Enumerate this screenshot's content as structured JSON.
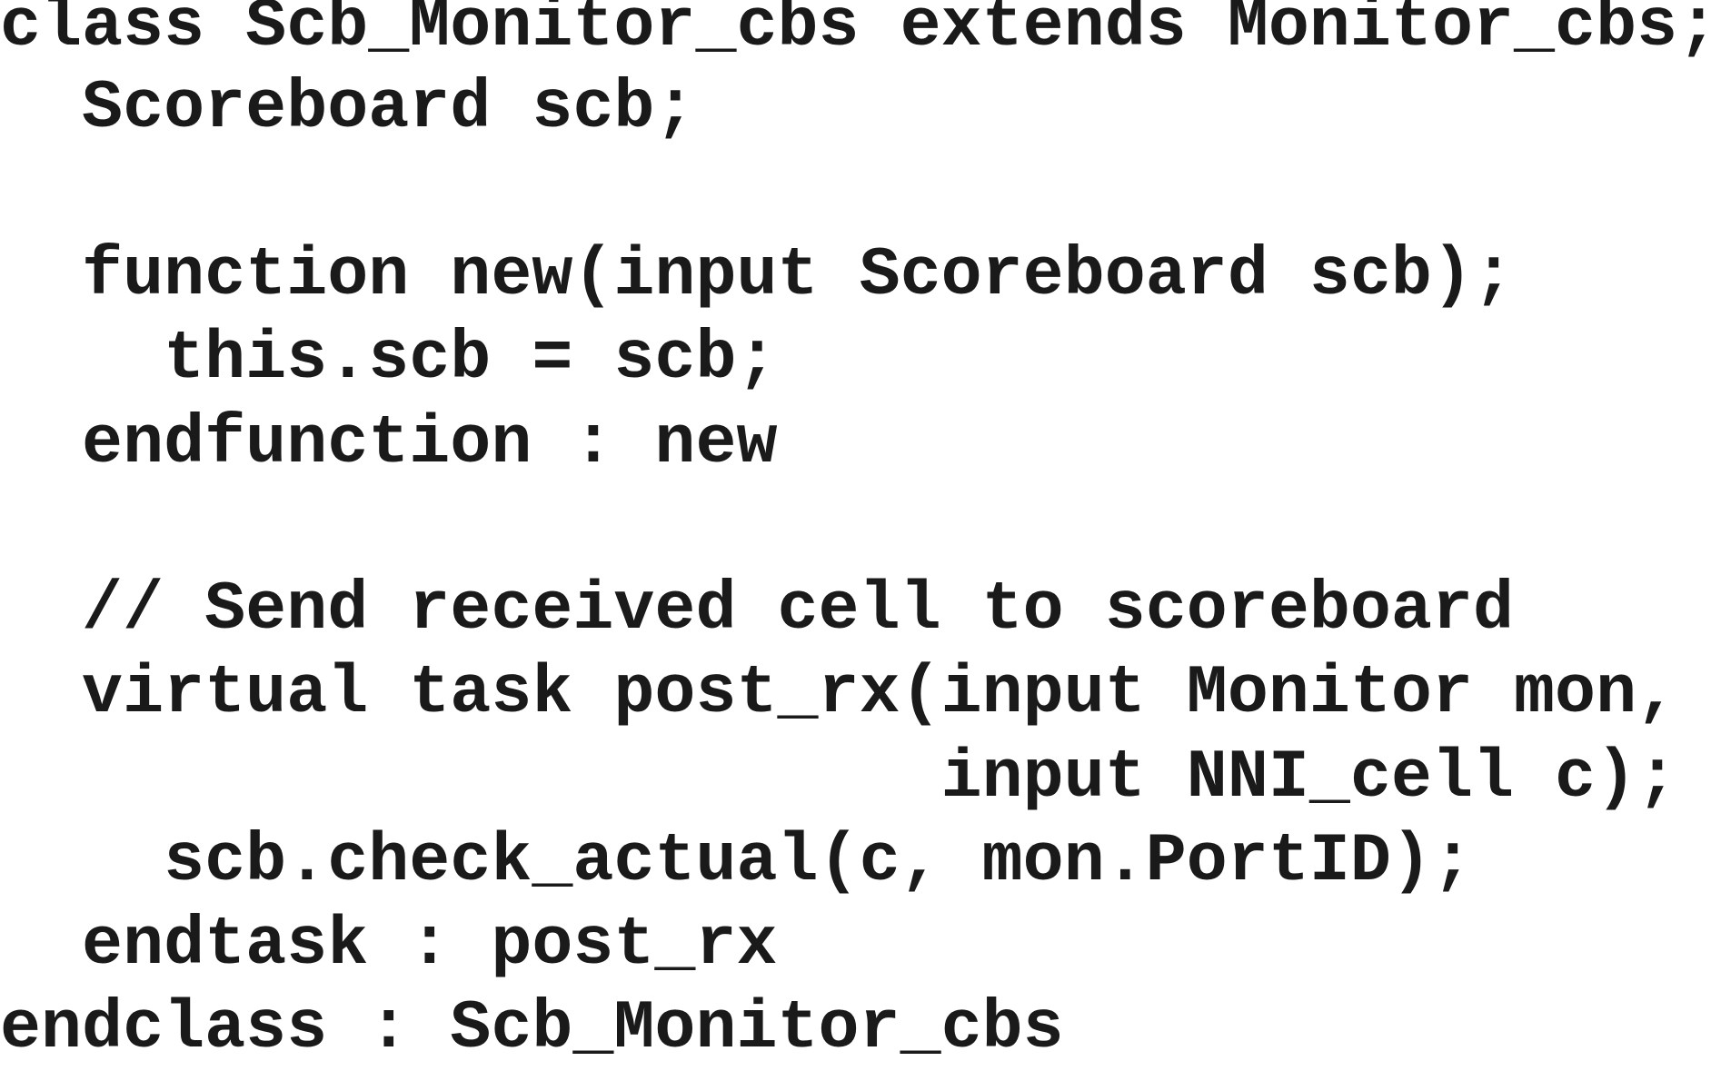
{
  "code": {
    "lines": [
      "class Scb_Monitor_cbs extends Monitor_cbs;",
      "  Scoreboard scb;",
      "  function new(input Scoreboard scb);",
      "    this.scb = scb;",
      "  endfunction : new",
      "  // Send received cell to scoreboard",
      "  virtual task post_rx(input Monitor mon,",
      "                       input NNI_cell c);",
      "    scb.check_actual(c, mon.PortID);",
      "  endtask : post_rx",
      "endclass : Scb_Monitor_cbs"
    ]
  }
}
